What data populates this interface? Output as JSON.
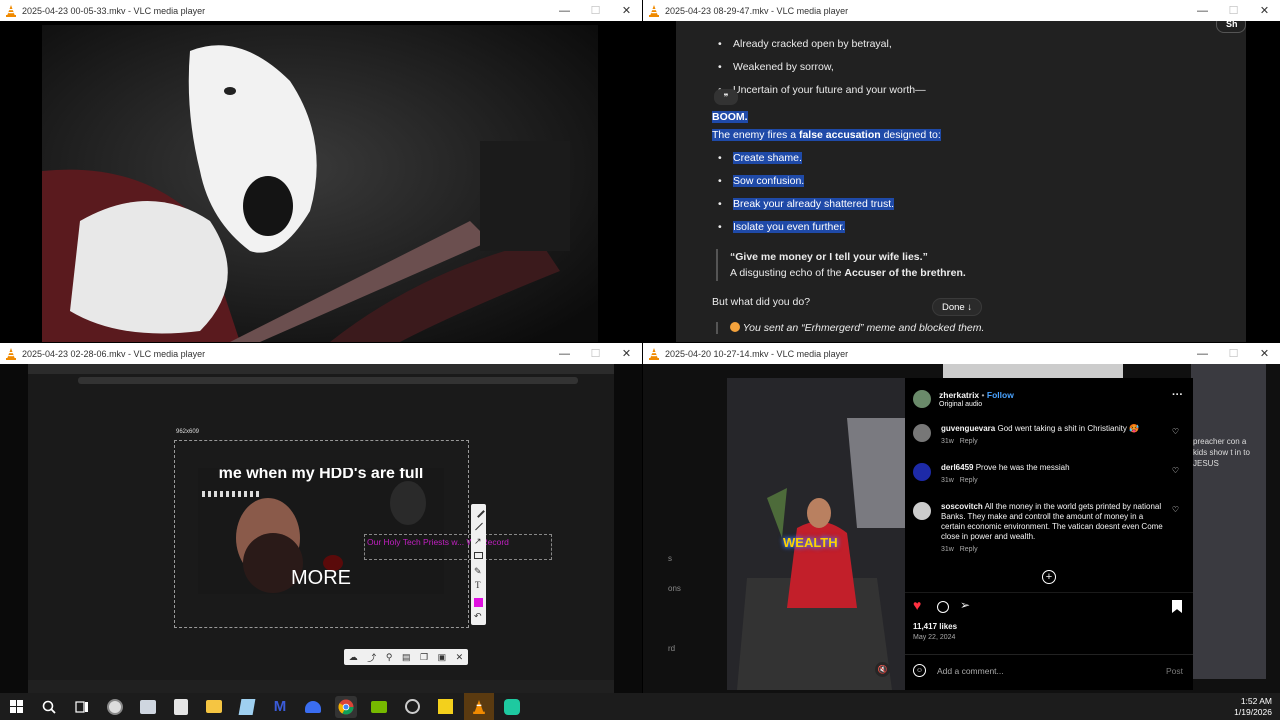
{
  "windows": [
    {
      "title": "2025-04-23 00-05-33.mkv - VLC media player"
    },
    {
      "title": "2025-04-23 08-29-47.mkv - VLC media player"
    },
    {
      "title": "2025-04-23 02-28-06.mkv - VLC media player"
    },
    {
      "title": "2025-04-20 10-27-14.mkv - VLC media player"
    }
  ],
  "controls": {
    "minimize": "—",
    "maximize": "☐",
    "close": "✕"
  },
  "chat": {
    "share_label": "Sh",
    "quote_glyph": "❞",
    "bullets_top": [
      "Already cracked open by betrayal,",
      "Weakened by sorrow,",
      "Uncertain of your future and your worth—"
    ],
    "boom": "BOOM.",
    "enemy_pre": "The enemy fires a ",
    "enemy_bold": "false accusation",
    "enemy_post": " designed to:",
    "bullets_hl": [
      "Create shame.",
      "Sow confusion.",
      "Break your already shattered trust.",
      "Isolate you even further."
    ],
    "quote_line1": "“Give me money or I tell your wife lies.”",
    "quote_line2_pre": "A disgusting echo of the ",
    "quote_line2_bold": "Accuser of the brethren.",
    "question": "But what did you do?",
    "done_label": "Done",
    "last_line": "You sent an “Erhmergerd” meme and blocked them."
  },
  "meme": {
    "dims": "962x609",
    "top_text": "me when my HDD's are full",
    "bottom_text": "MORE",
    "overlay_text": "Our Holy Tech Priests w... We Record"
  },
  "instagram": {
    "username": "zherkatrix",
    "follow": "Follow",
    "subtitle": "Original audio",
    "comments": [
      {
        "user": "guvenguevara",
        "text": "God went taking a shit in Christianity 🥵",
        "age": "31w",
        "reply": "Reply"
      },
      {
        "user": "derl6459",
        "text": "Prove he was the messiah",
        "age": "31w",
        "reply": "Reply"
      },
      {
        "user": "soscovitch",
        "text": "All the money in the world gets printed by national Banks. They make and controll the amount of money in a certain economic environment. The vatican doesnt even Come close in power and wealth.",
        "age": "31w",
        "reply": "Reply"
      }
    ],
    "likes": "11,417 likes",
    "date": "May 22, 2024",
    "add_comment": "Add a comment...",
    "post": "Post",
    "video_caption": "WEALTH",
    "left_letters": [
      "s",
      "ons",
      "rd"
    ],
    "bg_right_text": "preacher con a kids show t in to JESUS"
  },
  "taskbar": {
    "time": "1:52 AM",
    "date": "1/19/2026"
  },
  "colors": {
    "accent": "#1f4aa8",
    "vlc_orange": "#f08a00",
    "ig_link": "#4aa3ff",
    "like_red": "#ff3040"
  }
}
